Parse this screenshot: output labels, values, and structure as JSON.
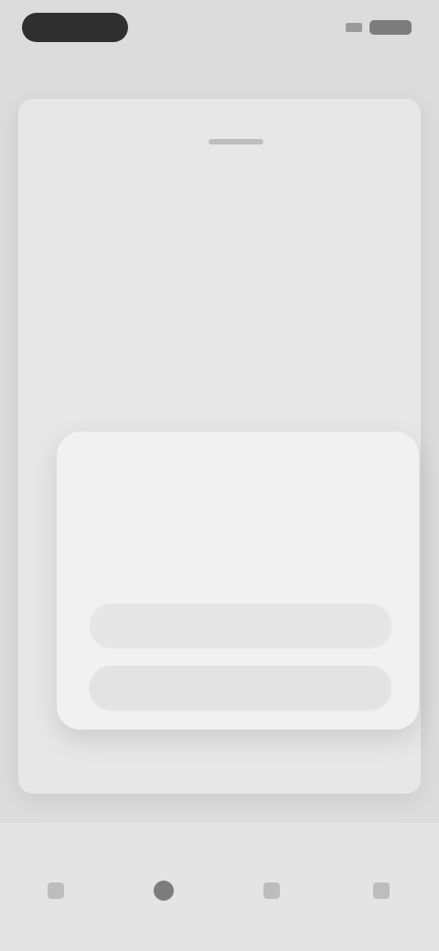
{
  "status": {
    "time": "",
    "icons": [
      "signal-icon",
      "battery-icon"
    ]
  },
  "sheet": {
    "title": "",
    "subtitle": "",
    "line": ""
  },
  "overlay": {
    "title": "",
    "body": "",
    "primary_label": "",
    "secondary_label": ""
  },
  "sheet_icons": [
    "doc-icon",
    "bookmark-icon",
    "share-icon",
    "menu-icon"
  ],
  "bottom_nav": {
    "items": [
      {
        "icon": "home-icon"
      },
      {
        "icon": "search-icon"
      },
      {
        "icon": "chat-icon"
      },
      {
        "icon": "profile-icon"
      }
    ]
  }
}
